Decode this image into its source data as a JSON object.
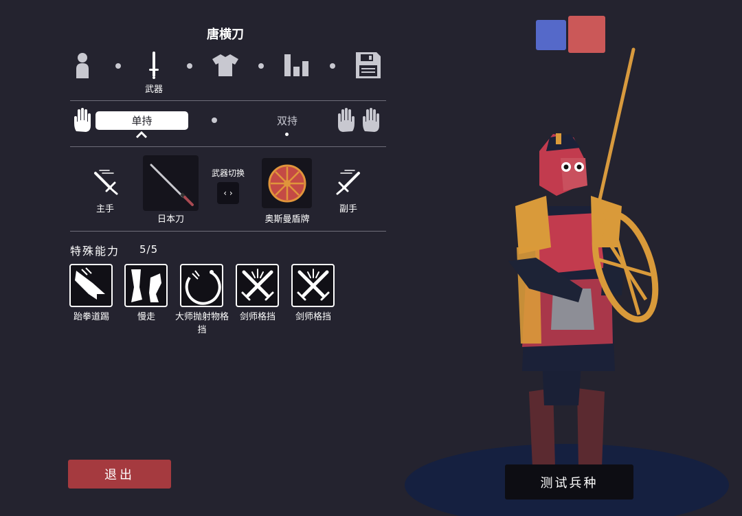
{
  "header": {
    "title": "唐横刀"
  },
  "categories": {
    "items": [
      {
        "icon": "person-icon"
      },
      {
        "icon": "sword-icon"
      },
      {
        "icon": "shirt-icon"
      },
      {
        "icon": "stats-icon"
      },
      {
        "icon": "save-icon"
      }
    ],
    "active_label": "武器"
  },
  "grip": {
    "single_label": "单持",
    "dual_label": "双持",
    "selected": "单持"
  },
  "weapons": {
    "main_hand_label": "主手",
    "main_weapon_label": "日本刀",
    "swap_label": "武器切换",
    "swap_glyph": "‹ ›",
    "off_weapon_label": "奥斯曼盾牌",
    "off_hand_label": "副手"
  },
  "abilities": {
    "title": "特殊能力",
    "count": "5/5",
    "items": [
      {
        "label": "跆拳道踢",
        "icon": "kick-icon"
      },
      {
        "label": "慢走",
        "icon": "legs-icon"
      },
      {
        "label": "大师抛射物格挡",
        "icon": "projectile-block-icon"
      },
      {
        "label": "剑师格挡",
        "icon": "crossed-swords-icon"
      },
      {
        "label": "剑师格挡",
        "icon": "crossed-swords-icon"
      }
    ]
  },
  "footer": {
    "exit_label": "退出",
    "test_label": "测试兵种"
  },
  "teams": {
    "blue": "#5569c9",
    "red": "#cb5858"
  }
}
